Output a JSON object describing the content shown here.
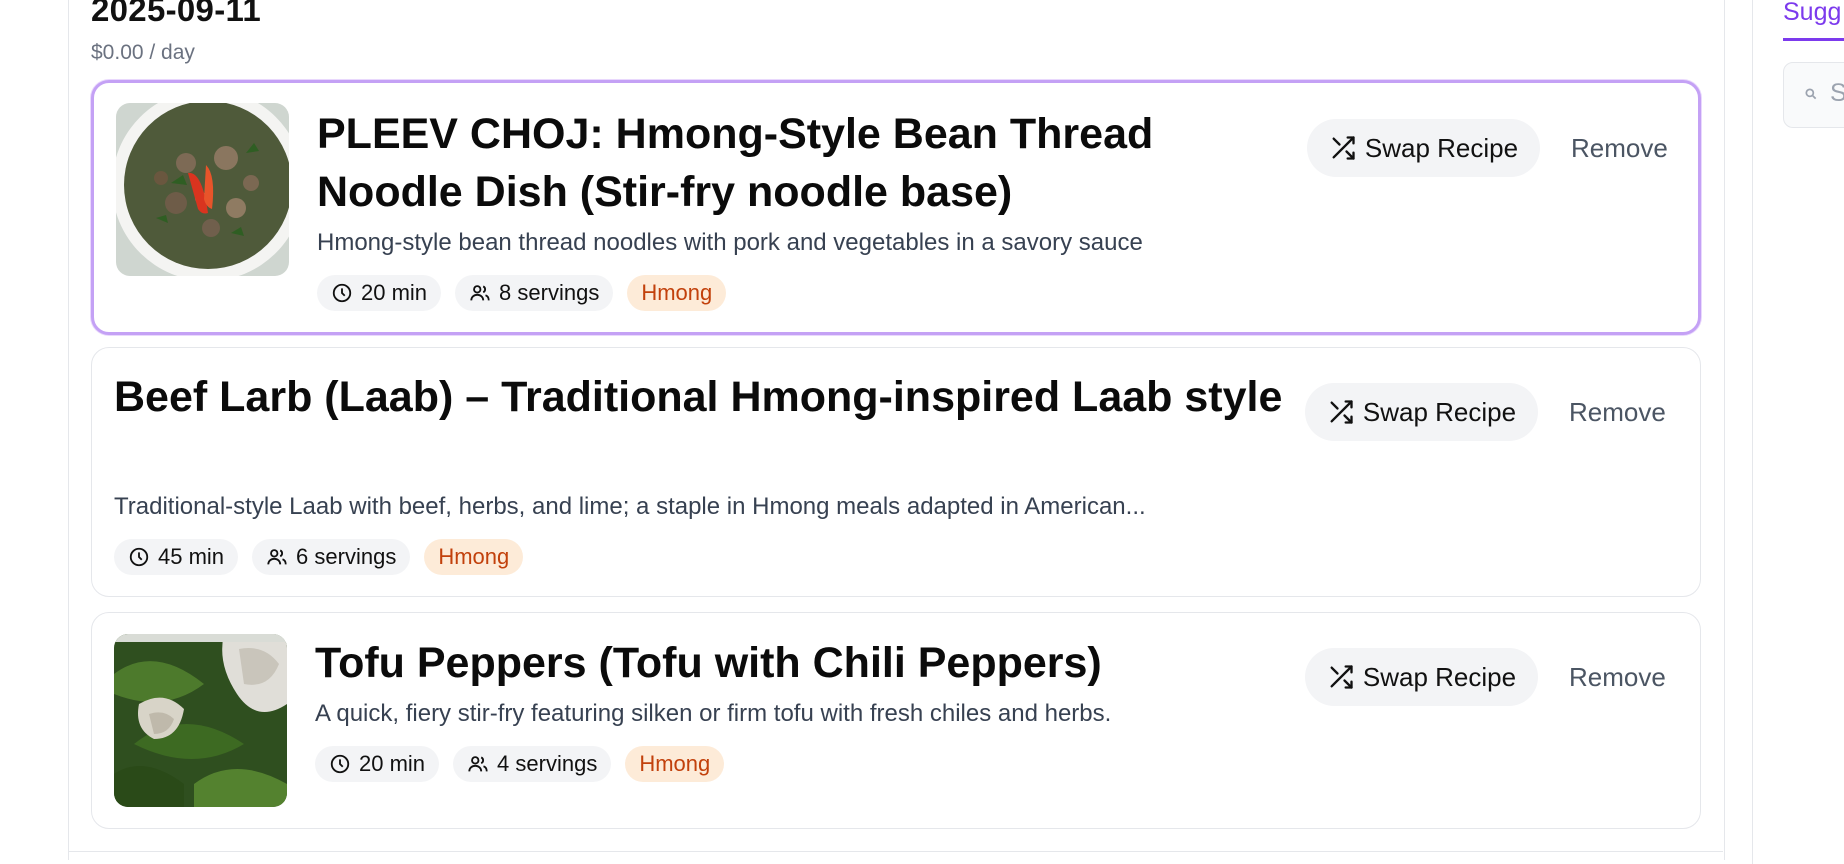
{
  "day": {
    "date": "2025-09-11",
    "cost": "$0.00 / day"
  },
  "recipes": [
    {
      "title": "PLEEV CHOJ: Hmong-Style Bean Thread Noodle Dish (Stir-fry noodle base)",
      "description": "Hmong-style bean thread noodles with pork and vegetables in a savory sauce",
      "time": "20 min",
      "servings": "8 servings",
      "cuisine": "Hmong",
      "has_image": true,
      "selected": true
    },
    {
      "title": "Beef Larb (Laab) – Traditional Hmong-inspired Laab style",
      "description": "Traditional-style Laab with beef, herbs, and lime; a staple in Hmong meals adapted in American...",
      "time": "45 min",
      "servings": "6 servings",
      "cuisine": "Hmong",
      "has_image": false,
      "selected": false
    },
    {
      "title": "Tofu Peppers (Tofu with Chili Peppers)",
      "description": "A quick, fiery stir-fry featuring silken or firm tofu with fresh chiles and herbs.",
      "time": "20 min",
      "servings": "4 servings",
      "cuisine": "Hmong",
      "has_image": true,
      "selected": false
    }
  ],
  "actions": {
    "swap_label": "Swap Recipe",
    "remove_label": "Remove"
  },
  "sidebar": {
    "tab_label": "Sugg",
    "search_placeholder": "S"
  },
  "colors": {
    "accent": "#7c3aed",
    "selected_border": "#c4a1f5",
    "tag_bg": "#fdebd8",
    "tag_text": "#c2410c"
  },
  "icons": {
    "time": "clock-icon",
    "servings": "users-icon",
    "swap": "shuffle-icon",
    "search": "search-icon"
  }
}
